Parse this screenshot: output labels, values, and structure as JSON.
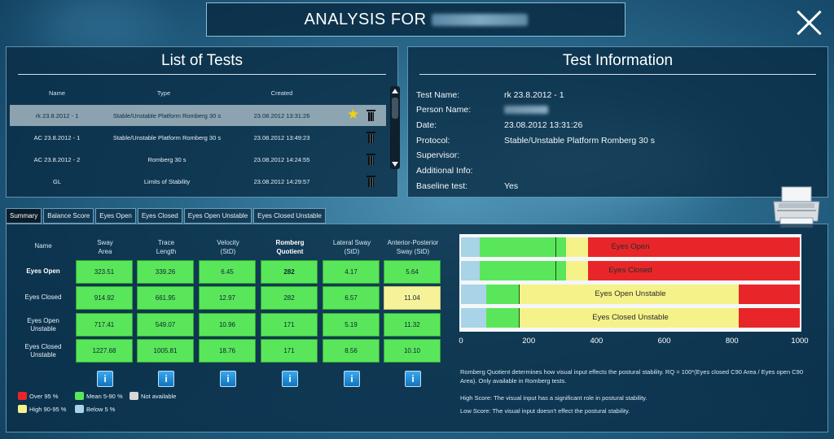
{
  "header": {
    "title": "ANALYSIS FOR"
  },
  "tests_panel": {
    "title": "List of Tests",
    "columns": [
      "Name",
      "Type",
      "Created"
    ],
    "rows": [
      {
        "name": "rk 23.8.2012 - 1",
        "type": "Stable/Unstable Platform Romberg 30 s",
        "created": "23.08.2012 13:31:26",
        "selected": true,
        "starred": true
      },
      {
        "name": "AC 23.8.2012 - 1",
        "type": "Stable/Unstable Platform Romberg 30 s",
        "created": "23.08.2012 13:49:23",
        "selected": false,
        "starred": false
      },
      {
        "name": "AC 23.8.2012 - 2",
        "type": "Romberg 30 s",
        "created": "23.08.2012 14:24:55",
        "selected": false,
        "starred": false
      },
      {
        "name": "GL",
        "type": "Limits of Stability",
        "created": "23.08.2012 14:29:57",
        "selected": false,
        "starred": false
      }
    ]
  },
  "info_panel": {
    "title": "Test Information",
    "rows": [
      {
        "label": "Test Name:",
        "value": "rk 23.8.2012 - 1"
      },
      {
        "label": "Person Name:",
        "value": ""
      },
      {
        "label": "Date:",
        "value": "23.08.2012 13:31:26"
      },
      {
        "label": "Protocol:",
        "value": "Stable/Unstable Platform Romberg 30 s"
      },
      {
        "label": "Supervisor:",
        "value": ""
      },
      {
        "label": "Additional Info:",
        "value": ""
      },
      {
        "label": "Baseline test:",
        "value": "Yes"
      }
    ]
  },
  "tabs": [
    "Summary",
    "Balance Score",
    "Eyes Open",
    "Eyes Closed",
    "Eyes Open Unstable",
    "Eyes Closed Unstable"
  ],
  "summary": {
    "name_header": "Name",
    "columns": [
      {
        "line1": "Sway",
        "line2": "Area"
      },
      {
        "line1": "Trace",
        "line2": "Length"
      },
      {
        "line1": "Velocity",
        "line2": "(StD)"
      },
      {
        "line1": "Romberg",
        "line2": "Quotient"
      },
      {
        "line1": "Lateral Sway",
        "line2": "(StD)"
      },
      {
        "line1": "Anterior-Posterior",
        "line2": "Sway (StD)"
      }
    ],
    "rows": [
      {
        "line1": "Eyes Open",
        "line2": "",
        "values": [
          "323.51",
          "339.26",
          "6.45",
          "282",
          "4.17",
          "5.64"
        ],
        "levels": [
          "mean",
          "mean",
          "mean",
          "mean",
          "mean",
          "mean"
        ]
      },
      {
        "line1": "Eyes Closed",
        "line2": "",
        "values": [
          "914.92",
          "661.95",
          "12.97",
          "282",
          "6.57",
          "11.04"
        ],
        "levels": [
          "mean",
          "mean",
          "mean",
          "mean",
          "mean",
          "high"
        ]
      },
      {
        "line1": "Eyes Open",
        "line2": "Unstable",
        "values": [
          "717.41",
          "549.07",
          "10.96",
          "171",
          "5.19",
          "11.32"
        ],
        "levels": [
          "mean",
          "mean",
          "mean",
          "mean",
          "mean",
          "mean"
        ]
      },
      {
        "line1": "Eyes Closed",
        "line2": "Unstable",
        "values": [
          "1227.68",
          "1005.81",
          "18.76",
          "171",
          "8.56",
          "10.10"
        ],
        "levels": [
          "mean",
          "mean",
          "mean",
          "mean",
          "mean",
          "mean"
        ]
      }
    ],
    "info_button_label": "i"
  },
  "legend": [
    {
      "label": "Over 95 %",
      "color": "#e8262a"
    },
    {
      "label": "Mean 5-90 %",
      "color": "#5ae65a"
    },
    {
      "label": "Not available",
      "color": "#d8d8d8"
    },
    {
      "label": "High 90-95 %",
      "color": "#f5f28a"
    },
    {
      "label": "Below 5 %",
      "color": "#a9d3e6"
    }
  ],
  "chart_data": {
    "type": "bar",
    "orientation": "horizontal-stacked-ranges",
    "xlim": [
      0,
      1000
    ],
    "xticks": [
      0,
      200,
      400,
      600,
      800,
      1000
    ],
    "series": [
      {
        "name": "Eyes Open",
        "segments": [
          {
            "to": 55,
            "color": "#a9d3e6"
          },
          {
            "to": 280,
            "color": "#5ae65a"
          },
          {
            "to": 310,
            "color": "#5ae65a"
          },
          {
            "to": 375,
            "color": "#f5f28a"
          },
          {
            "to": 1000,
            "color": "#e8262a"
          }
        ],
        "marker": 280
      },
      {
        "name": "Eyes Closed",
        "segments": [
          {
            "to": 55,
            "color": "#a9d3e6"
          },
          {
            "to": 280,
            "color": "#5ae65a"
          },
          {
            "to": 310,
            "color": "#5ae65a"
          },
          {
            "to": 375,
            "color": "#f5f28a"
          },
          {
            "to": 1000,
            "color": "#e8262a"
          }
        ],
        "marker": 280
      },
      {
        "name": "Eyes Open Unstable",
        "segments": [
          {
            "to": 75,
            "color": "#a9d3e6"
          },
          {
            "to": 170,
            "color": "#5ae65a"
          },
          {
            "to": 820,
            "color": "#f5f28a"
          },
          {
            "to": 1000,
            "color": "#e8262a"
          }
        ],
        "marker": 170,
        "green_to": 525
      },
      {
        "name": "Eyes Closed Unstable",
        "segments": [
          {
            "to": 75,
            "color": "#a9d3e6"
          },
          {
            "to": 170,
            "color": "#5ae65a"
          },
          {
            "to": 820,
            "color": "#f5f28a"
          },
          {
            "to": 1000,
            "color": "#e8262a"
          }
        ],
        "marker": 170,
        "green_to": 525
      }
    ]
  },
  "notes": {
    "rq": "Romberg Quotient determines how visual input effects the postural stability. RQ = 100*(Eyes closed C90 Area / Eyes open C90 Area). Only available in Romberg tests.",
    "high": "High Score:   The visual input has a significant role in postural stability.",
    "low": "Low Score:   The visual input doesn't effect the postural stability."
  }
}
